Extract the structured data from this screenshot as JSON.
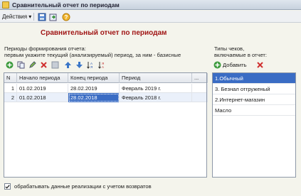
{
  "window": {
    "title": "Сравнительный отчет по периодам"
  },
  "toolbar": {
    "actions_label": "Действия"
  },
  "report": {
    "heading": "Сравнительный отчет по периодам"
  },
  "periods": {
    "hint_line1": "Периоды формирования отчета:",
    "hint_line2": "первым укажите текущий (анализируемый) период, за ним - базисные",
    "columns": [
      "N",
      "Начало периода",
      "Конец периода",
      "Период",
      "..."
    ],
    "rows": [
      {
        "n": "1",
        "start": "01.02.2019",
        "end": "28.02.2019",
        "period": "Февраль 2019 г.",
        "extra": ""
      },
      {
        "n": "2",
        "start": "01.02.2018",
        "end": "28.02.2018",
        "period": "Февраль 2018 г.",
        "extra": ""
      }
    ]
  },
  "check_types": {
    "hint_line1": "Типы чеков,",
    "hint_line2": "включаемые в отчет:",
    "add_label": "Добавить",
    "items": [
      "1.Обычный",
      "3. Безнал отгруженый",
      "2.Интернет-магазин",
      "Масло"
    ],
    "selected_index": 0
  },
  "options": {
    "returns_label": "обрабатывать данные реализации с учетом возвратов",
    "returns_checked": true
  },
  "colors": {
    "heading": "#a01515",
    "selection": "#3a6cc4"
  }
}
